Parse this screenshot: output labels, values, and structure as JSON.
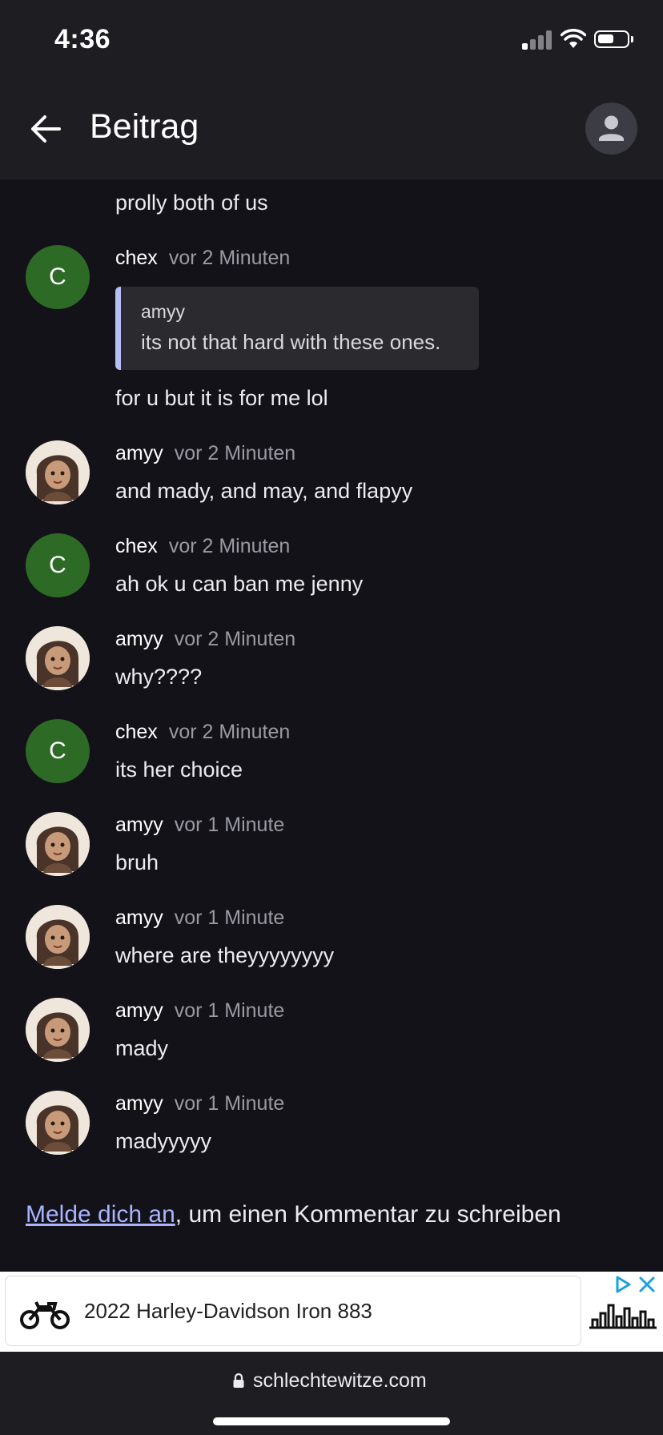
{
  "status_bar": {
    "time": "4:36"
  },
  "header": {
    "title": "Beitrag"
  },
  "partial_message": "prolly both of us",
  "comments": [
    {
      "author": "chex",
      "time": "vor 2 Minuten",
      "avatar_letter": "C",
      "quote": {
        "author": "amyy",
        "text": "its not that hard with these ones."
      },
      "text": "for u but it is for me lol"
    },
    {
      "author": "amyy",
      "time": "vor 2 Minuten",
      "text": "and mady, and may, and flapyy"
    },
    {
      "author": "chex",
      "time": "vor 2 Minuten",
      "avatar_letter": "C",
      "text": "ah ok u can ban me jenny"
    },
    {
      "author": "amyy",
      "time": "vor 2 Minuten",
      "text": "why????"
    },
    {
      "author": "chex",
      "time": "vor 2 Minuten",
      "avatar_letter": "C",
      "text": "its her choice"
    },
    {
      "author": "amyy",
      "time": "vor 1 Minute",
      "text": "bruh"
    },
    {
      "author": "amyy",
      "time": "vor 1 Minute",
      "text": "where are theyyyyyyyy"
    },
    {
      "author": "amyy",
      "time": "vor 1 Minute",
      "text": "mady"
    },
    {
      "author": "amyy",
      "time": "vor 1 Minute",
      "text": "madyyyyy"
    }
  ],
  "login_prompt": {
    "link": "Melde dich an",
    "rest": ", um einen Kommentar zu schreiben"
  },
  "ad": {
    "text": "2022 Harley-Davidson Iron 883"
  },
  "browser": {
    "url": "schlechtewitze.com"
  },
  "colors": {
    "avatar_green": "#2d6a26",
    "link": "#aab3ff",
    "quote_bar": "#b7bdf5",
    "background": "#131218"
  },
  "icons": [
    "back-arrow-icon",
    "user-icon",
    "lock-icon",
    "ad-choices-icon",
    "close-icon",
    "signal-icon",
    "wifi-icon",
    "battery-icon"
  ]
}
